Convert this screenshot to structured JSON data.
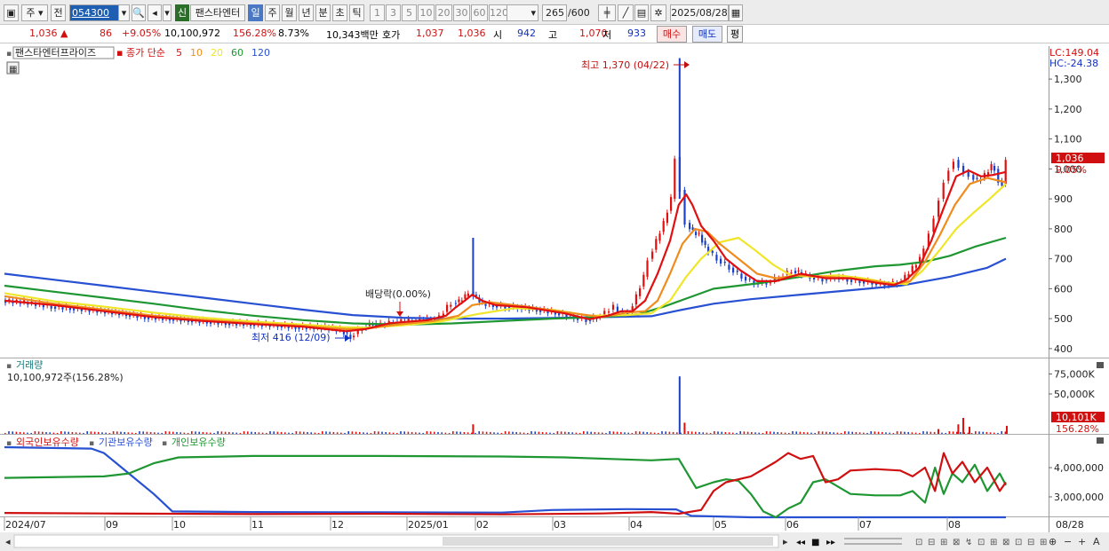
{
  "toolbar": {
    "type_label": "주",
    "prefix_label": "전",
    "stock_code": "054300",
    "credit_badge": "신",
    "stock_short": "팬스타엔터",
    "periods": [
      "일",
      "주",
      "월",
      "년",
      "분",
      "초",
      "틱"
    ],
    "active_period": "일",
    "minute_options": [
      "1",
      "3",
      "5",
      "10",
      "20",
      "30",
      "60",
      "120"
    ],
    "count": "265",
    "total": "/600",
    "date": "2025/08/28"
  },
  "quote": {
    "price": "1,036 ▲",
    "change": "86",
    "change_pct": "+9.05%",
    "volume": "10,100,972",
    "volume_ratio": "156.28%",
    "turnover": "8.73%",
    "trade_value": "10,343백만",
    "hoga_label": "호가",
    "ask": "1,037",
    "bid": "1,036",
    "open_label": "시",
    "open": "942",
    "high_label": "고",
    "high": "1,070",
    "low_label": "저",
    "low": "933",
    "buy_btn": "매수",
    "sell_btn": "매도",
    "eval_btn": "평"
  },
  "legend": {
    "stock_name": "팬스타엔터프라이즈",
    "ma_label": "종가 단순",
    "ma": [
      {
        "period": "5",
        "color": "#e01010"
      },
      {
        "period": "10",
        "color": "#f08c1e"
      },
      {
        "period": "20",
        "color": "#f0e628"
      },
      {
        "period": "60",
        "color": "#1e9632"
      },
      {
        "period": "120",
        "color": "#2850d2"
      }
    ],
    "lc": "LC:149.04",
    "hc": "HC:-24.38"
  },
  "annotations": {
    "high": "최고 1,370 (04/22)",
    "low": "최저 416 (12/09)",
    "dividend": "배당락(0.00%)"
  },
  "price_axis": {
    "ticks": [
      400,
      500,
      600,
      700,
      800,
      900,
      1000,
      1100,
      1200,
      1300
    ],
    "tick_labels": [
      "400",
      "500",
      "600",
      "700",
      "800",
      "900",
      "1,000",
      "1,100",
      "1,200",
      "1,300"
    ],
    "current_label": "1,036",
    "current_pct": "9.05%",
    "ylim": [
      370,
      1410
    ]
  },
  "volume_panel": {
    "title": "거래량",
    "value": "10,100,972주(156.28%)",
    "ticks": [
      "50,000K",
      "75,000K"
    ],
    "current_label": "10,101K",
    "current_pct": "156.28%"
  },
  "holdings_panel": {
    "labels": [
      "외국인보유수량",
      "기관보유수량",
      "개인보유수량"
    ],
    "label_colors": [
      "#d01010",
      "#2850d2",
      "#1e9632"
    ],
    "ticks": [
      "3,000,000",
      "4,000,000"
    ]
  },
  "x_axis": {
    "labels": [
      "2024/07",
      "09",
      "10",
      "11",
      "12",
      "2025/01",
      "02",
      "03",
      "04",
      "05",
      "06",
      "07",
      "08"
    ],
    "end_label": "08/28"
  },
  "chart_data": {
    "type": "candlestick",
    "title": "팬스타엔터프라이즈",
    "x_range": [
      "2024/07",
      "2025/08/28"
    ],
    "ylim": [
      370,
      1410
    ],
    "last_candle": {
      "open": 942,
      "high": 1070,
      "low": 933,
      "close": 1036
    },
    "volume": 10100972,
    "price_path": [
      [
        0,
        560
      ],
      [
        18,
        555
      ],
      [
        40,
        540
      ],
      [
        55,
        535
      ],
      [
        80,
        525
      ],
      [
        100,
        515
      ],
      [
        115,
        505
      ],
      [
        135,
        500
      ],
      [
        150,
        495
      ],
      [
        165,
        490
      ],
      [
        180,
        485
      ],
      [
        200,
        482
      ],
      [
        222,
        478
      ],
      [
        236,
        472
      ],
      [
        260,
        470
      ],
      [
        272,
        462
      ],
      [
        280,
        438
      ],
      [
        290,
        470
      ],
      [
        298,
        485
      ],
      [
        305,
        480
      ],
      [
        315,
        490
      ],
      [
        330,
        495
      ],
      [
        345,
        498
      ],
      [
        352,
        505
      ],
      [
        358,
        540
      ],
      [
        362,
        552
      ],
      [
        367,
        558
      ],
      [
        372,
        575
      ],
      [
        376,
        590
      ],
      [
        381,
        570
      ],
      [
        386,
        550
      ],
      [
        395,
        545
      ],
      [
        405,
        540
      ],
      [
        415,
        538
      ],
      [
        430,
        530
      ],
      [
        445,
        520
      ],
      [
        460,
        505
      ],
      [
        470,
        495
      ],
      [
        478,
        505
      ],
      [
        485,
        520
      ],
      [
        492,
        540
      ],
      [
        496,
        525
      ],
      [
        500,
        522
      ],
      [
        504,
        520
      ],
      [
        510,
        575
      ],
      [
        516,
        640
      ],
      [
        520,
        700
      ],
      [
        526,
        760
      ],
      [
        532,
        820
      ],
      [
        538,
        900
      ],
      [
        542,
        1040
      ],
      [
        546,
        930
      ],
      [
        550,
        820
      ],
      [
        555,
        790
      ],
      [
        560,
        780
      ],
      [
        565,
        740
      ],
      [
        575,
        700
      ],
      [
        585,
        670
      ],
      [
        595,
        640
      ],
      [
        605,
        620
      ],
      [
        615,
        620
      ],
      [
        625,
        640
      ],
      [
        635,
        660
      ],
      [
        640,
        655
      ],
      [
        650,
        640
      ],
      [
        660,
        630
      ],
      [
        670,
        640
      ],
      [
        680,
        630
      ],
      [
        690,
        625
      ],
      [
        700,
        620
      ],
      [
        710,
        615
      ],
      [
        720,
        620
      ],
      [
        726,
        640
      ],
      [
        732,
        670
      ],
      [
        738,
        700
      ],
      [
        742,
        740
      ],
      [
        746,
        790
      ],
      [
        750,
        840
      ],
      [
        754,
        900
      ],
      [
        758,
        960
      ],
      [
        762,
        1000
      ],
      [
        766,
        1030
      ],
      [
        770,
        1010
      ],
      [
        774,
        990
      ],
      [
        778,
        980
      ],
      [
        784,
        960
      ],
      [
        790,
        980
      ],
      [
        795,
        1010
      ],
      [
        798,
        1000
      ],
      [
        801,
        960
      ],
      [
        804,
        950
      ],
      [
        807,
        1036
      ]
    ],
    "ma5": [
      [
        0,
        560
      ],
      [
        40,
        545
      ],
      [
        80,
        525
      ],
      [
        120,
        505
      ],
      [
        160,
        492
      ],
      [
        200,
        482
      ],
      [
        240,
        473
      ],
      [
        275,
        458
      ],
      [
        290,
        465
      ],
      [
        310,
        485
      ],
      [
        340,
        495
      ],
      [
        355,
        510
      ],
      [
        362,
        535
      ],
      [
        370,
        560
      ],
      [
        376,
        580
      ],
      [
        384,
        560
      ],
      [
        395,
        545
      ],
      [
        420,
        538
      ],
      [
        450,
        518
      ],
      [
        470,
        498
      ],
      [
        485,
        510
      ],
      [
        496,
        525
      ],
      [
        505,
        525
      ],
      [
        515,
        560
      ],
      [
        525,
        650
      ],
      [
        535,
        760
      ],
      [
        542,
        880
      ],
      [
        548,
        915
      ],
      [
        553,
        880
      ],
      [
        560,
        810
      ],
      [
        570,
        760
      ],
      [
        580,
        700
      ],
      [
        592,
        660
      ],
      [
        605,
        625
      ],
      [
        620,
        625
      ],
      [
        640,
        650
      ],
      [
        660,
        635
      ],
      [
        680,
        635
      ],
      [
        700,
        620
      ],
      [
        715,
        612
      ],
      [
        725,
        630
      ],
      [
        735,
        670
      ],
      [
        745,
        760
      ],
      [
        755,
        870
      ],
      [
        765,
        975
      ],
      [
        775,
        995
      ],
      [
        785,
        975
      ],
      [
        795,
        980
      ],
      [
        805,
        990
      ]
    ],
    "ma10": [
      [
        0,
        575
      ],
      [
        40,
        550
      ],
      [
        80,
        530
      ],
      [
        120,
        510
      ],
      [
        160,
        496
      ],
      [
        200,
        485
      ],
      [
        240,
        476
      ],
      [
        275,
        465
      ],
      [
        290,
        466
      ],
      [
        315,
        480
      ],
      [
        345,
        492
      ],
      [
        365,
        510
      ],
      [
        376,
        545
      ],
      [
        390,
        555
      ],
      [
        420,
        540
      ],
      [
        450,
        522
      ],
      [
        480,
        505
      ],
      [
        500,
        520
      ],
      [
        515,
        525
      ],
      [
        525,
        560
      ],
      [
        535,
        650
      ],
      [
        545,
        750
      ],
      [
        555,
        800
      ],
      [
        565,
        790
      ],
      [
        575,
        750
      ],
      [
        590,
        700
      ],
      [
        605,
        650
      ],
      [
        620,
        635
      ],
      [
        640,
        645
      ],
      [
        660,
        640
      ],
      [
        680,
        635
      ],
      [
        700,
        625
      ],
      [
        715,
        615
      ],
      [
        728,
        625
      ],
      [
        740,
        690
      ],
      [
        752,
        780
      ],
      [
        764,
        880
      ],
      [
        776,
        950
      ],
      [
        790,
        970
      ],
      [
        805,
        955
      ]
    ],
    "ma20": [
      [
        0,
        585
      ],
      [
        40,
        558
      ],
      [
        80,
        540
      ],
      [
        120,
        520
      ],
      [
        160,
        503
      ],
      [
        200,
        490
      ],
      [
        240,
        480
      ],
      [
        270,
        472
      ],
      [
        290,
        470
      ],
      [
        320,
        478
      ],
      [
        350,
        490
      ],
      [
        380,
        515
      ],
      [
        410,
        535
      ],
      [
        440,
        530
      ],
      [
        470,
        510
      ],
      [
        500,
        512
      ],
      [
        520,
        518
      ],
      [
        535,
        560
      ],
      [
        548,
        640
      ],
      [
        560,
        700
      ],
      [
        575,
        755
      ],
      [
        590,
        770
      ],
      [
        603,
        730
      ],
      [
        618,
        680
      ],
      [
        632,
        645
      ],
      [
        650,
        640
      ],
      [
        670,
        645
      ],
      [
        690,
        635
      ],
      [
        710,
        620
      ],
      [
        725,
        615
      ],
      [
        738,
        660
      ],
      [
        752,
        730
      ],
      [
        765,
        800
      ],
      [
        778,
        850
      ],
      [
        792,
        900
      ],
      [
        805,
        950
      ]
    ],
    "ma60": [
      [
        0,
        610
      ],
      [
        40,
        590
      ],
      [
        80,
        570
      ],
      [
        120,
        550
      ],
      [
        160,
        528
      ],
      [
        200,
        510
      ],
      [
        240,
        495
      ],
      [
        280,
        484
      ],
      [
        320,
        480
      ],
      [
        360,
        484
      ],
      [
        400,
        492
      ],
      [
        440,
        500
      ],
      [
        480,
        505
      ],
      [
        510,
        515
      ],
      [
        530,
        540
      ],
      [
        550,
        570
      ],
      [
        570,
        600
      ],
      [
        590,
        610
      ],
      [
        610,
        620
      ],
      [
        640,
        640
      ],
      [
        670,
        660
      ],
      [
        700,
        675
      ],
      [
        720,
        680
      ],
      [
        740,
        690
      ],
      [
        760,
        710
      ],
      [
        780,
        740
      ],
      [
        805,
        770
      ]
    ],
    "ma120": [
      [
        0,
        650
      ],
      [
        40,
        630
      ],
      [
        80,
        610
      ],
      [
        120,
        590
      ],
      [
        160,
        570
      ],
      [
        200,
        550
      ],
      [
        240,
        530
      ],
      [
        280,
        512
      ],
      [
        320,
        503
      ],
      [
        360,
        500
      ],
      [
        400,
        500
      ],
      [
        440,
        502
      ],
      [
        480,
        505
      ],
      [
        520,
        508
      ],
      [
        545,
        530
      ],
      [
        570,
        550
      ],
      [
        600,
        565
      ],
      [
        640,
        580
      ],
      [
        680,
        595
      ],
      [
        720,
        610
      ],
      [
        760,
        640
      ],
      [
        790,
        670
      ],
      [
        805,
        700
      ]
    ],
    "volume_spikes": [
      {
        "x": 376,
        "value": 12000
      },
      {
        "x": 542,
        "value": 72000
      },
      {
        "x": 546,
        "value": 14000
      },
      {
        "x": 766,
        "value": 12000
      },
      {
        "x": 770,
        "value": 20000
      },
      {
        "x": 775,
        "value": 9000
      },
      {
        "x": 750,
        "value": 6000
      },
      {
        "x": 805,
        "value": 10101
      }
    ],
    "foreign_holding": [
      [
        0,
        2450000
      ],
      [
        80,
        2430000
      ],
      [
        200,
        2410000
      ],
      [
        300,
        2420000
      ],
      [
        400,
        2400000
      ],
      [
        480,
        2430000
      ],
      [
        520,
        2480000
      ],
      [
        542,
        2420000
      ],
      [
        560,
        2550000
      ],
      [
        570,
        3200000
      ],
      [
        580,
        3500000
      ],
      [
        600,
        3700000
      ],
      [
        620,
        4200000
      ],
      [
        630,
        4500000
      ],
      [
        640,
        4300000
      ],
      [
        650,
        4400000
      ],
      [
        660,
        3500000
      ],
      [
        670,
        3600000
      ],
      [
        680,
        3900000
      ],
      [
        700,
        3950000
      ],
      [
        720,
        3900000
      ],
      [
        730,
        3700000
      ],
      [
        740,
        4000000
      ],
      [
        748,
        3200000
      ],
      [
        755,
        4500000
      ],
      [
        762,
        3800000
      ],
      [
        770,
        4200000
      ],
      [
        780,
        3500000
      ],
      [
        790,
        4000000
      ],
      [
        800,
        3200000
      ],
      [
        805,
        3500000
      ]
    ],
    "institution_holding": [
      [
        0,
        4700000
      ],
      [
        70,
        4650000
      ],
      [
        80,
        4500000
      ],
      [
        100,
        3800000
      ],
      [
        120,
        3100000
      ],
      [
        135,
        2500000
      ],
      [
        200,
        2480000
      ],
      [
        300,
        2470000
      ],
      [
        400,
        2460000
      ],
      [
        440,
        2550000
      ],
      [
        500,
        2580000
      ],
      [
        540,
        2570000
      ],
      [
        552,
        2350000
      ],
      [
        600,
        2300000
      ],
      [
        700,
        2300000
      ],
      [
        805,
        2300000
      ]
    ],
    "individual_holding": [
      [
        0,
        3650000
      ],
      [
        80,
        3700000
      ],
      [
        100,
        3800000
      ],
      [
        120,
        4150000
      ],
      [
        140,
        4350000
      ],
      [
        200,
        4400000
      ],
      [
        300,
        4400000
      ],
      [
        400,
        4380000
      ],
      [
        450,
        4350000
      ],
      [
        520,
        4250000
      ],
      [
        542,
        4300000
      ],
      [
        556,
        3300000
      ],
      [
        570,
        3500000
      ],
      [
        580,
        3600000
      ],
      [
        590,
        3550000
      ],
      [
        600,
        3100000
      ],
      [
        610,
        2500000
      ],
      [
        620,
        2300000
      ],
      [
        630,
        2600000
      ],
      [
        640,
        2800000
      ],
      [
        650,
        3500000
      ],
      [
        660,
        3600000
      ],
      [
        670,
        3350000
      ],
      [
        680,
        3100000
      ],
      [
        700,
        3050000
      ],
      [
        720,
        3050000
      ],
      [
        730,
        3200000
      ],
      [
        740,
        2800000
      ],
      [
        748,
        4000000
      ],
      [
        755,
        3100000
      ],
      [
        762,
        3800000
      ],
      [
        770,
        3500000
      ],
      [
        780,
        4100000
      ],
      [
        790,
        3200000
      ],
      [
        800,
        3800000
      ],
      [
        805,
        3400000
      ]
    ]
  }
}
